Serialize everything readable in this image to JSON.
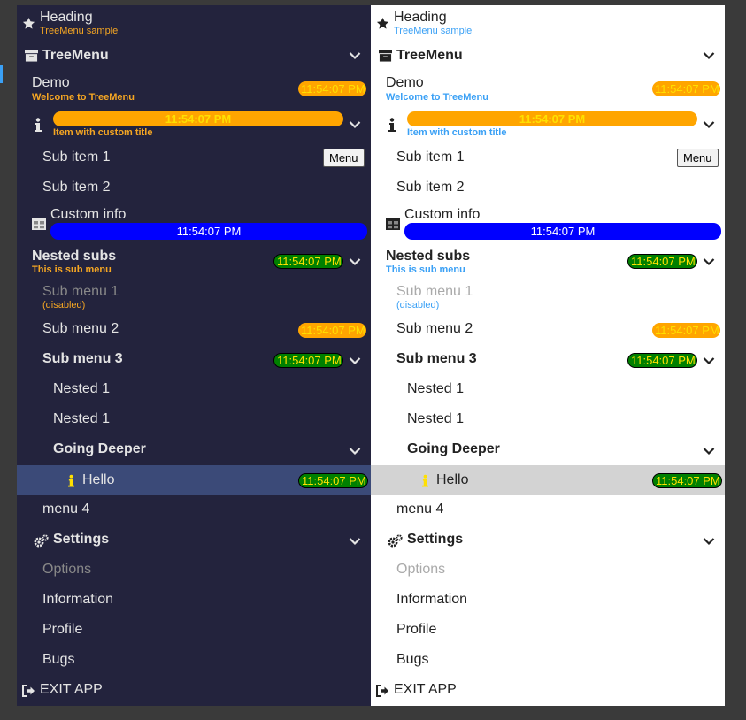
{
  "heading": {
    "title": "Heading",
    "subtitle": "TreeMenu sample"
  },
  "tree": {
    "label": "TreeMenu",
    "demo": {
      "label": "Demo",
      "subtitle": "Welcome to TreeMenu",
      "badge": "11:54:07 PM"
    },
    "custom_title": {
      "badge": "11:54:07 PM",
      "subtitle": "Item with custom title"
    },
    "sub_item_1": {
      "label": "Sub item 1",
      "button": "Menu"
    },
    "sub_item_2": {
      "label": "Sub item 2"
    },
    "custom_info": {
      "label": "Custom info",
      "badge": "11:54:07 PM"
    },
    "nested_subs": {
      "label": "Nested subs",
      "subtitle": "This is sub menu",
      "badge": "11:54:07 PM",
      "sub_menu_1": {
        "label": "Sub menu 1",
        "subtitle": "(disabled)"
      },
      "sub_menu_2": {
        "label": "Sub menu 2",
        "badge": "11:54:07 PM"
      },
      "sub_menu_3": {
        "label": "Sub menu 3",
        "badge": "11:54:07 PM",
        "nested_1a": "Nested 1",
        "nested_1b": "Nested 1",
        "going_deeper": {
          "label": "Going Deeper",
          "hello": {
            "label": "Hello",
            "badge": "11:54:07 PM"
          }
        }
      }
    },
    "menu_4": "menu 4"
  },
  "settings": {
    "label": "Settings",
    "items": [
      "Options",
      "Information",
      "Profile",
      "Bugs"
    ]
  },
  "exit": "EXIT APP",
  "colors": {
    "dark_bg": "#23233d",
    "light_bg": "#ffffff",
    "dark_subtitle": "#f5a623",
    "light_subtitle": "#3aa0f5",
    "badge_orange": "#ffa500",
    "badge_green": "#008000",
    "badge_blue": "#0000ff",
    "badge_text": "#ffe000",
    "highlight_dark": "#3b4a78",
    "highlight_light": "#d3d3d3"
  },
  "icons": {
    "heading": "star-icon",
    "tree": "archive-icon",
    "custom_title": "info-icon",
    "custom_info": "table-icon",
    "hello": "info-icon",
    "settings": "gears-icon",
    "exit": "sign-out-icon",
    "expand": "chevron-down-icon"
  }
}
